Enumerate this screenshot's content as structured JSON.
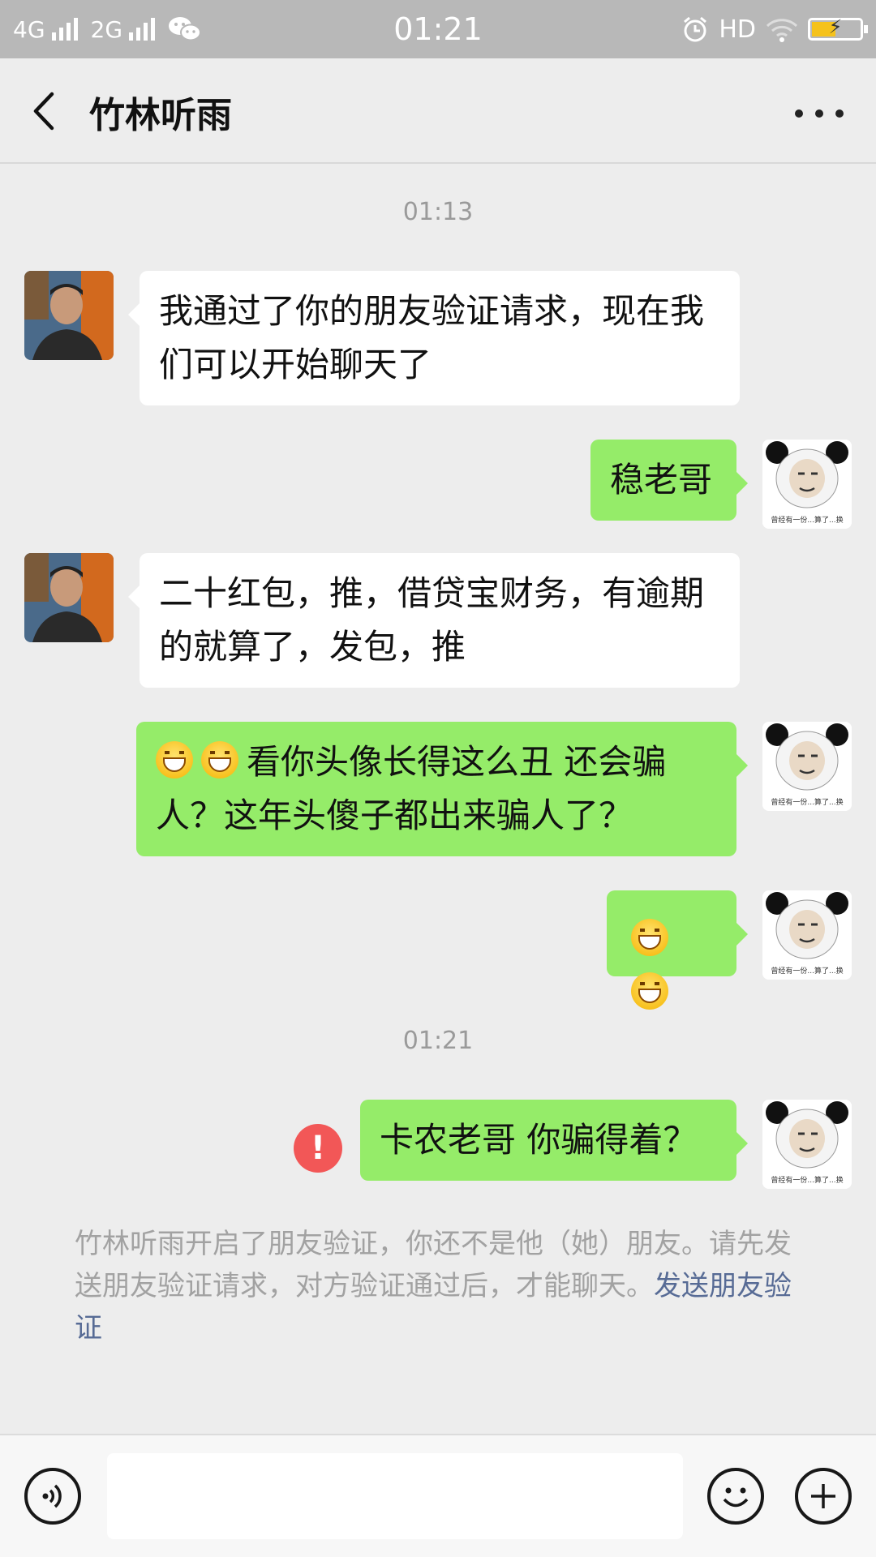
{
  "status_bar": {
    "network1": "4G",
    "network2": "2G",
    "time": "01:21",
    "hd": "HD"
  },
  "header": {
    "title": "竹林听雨"
  },
  "chat": {
    "timestamps": [
      "01:13",
      "01:21"
    ],
    "messages": [
      {
        "side": "in",
        "text": "我通过了你的朋友验证请求，现在我们可以开始聊天了"
      },
      {
        "side": "out",
        "text": "稳老哥"
      },
      {
        "side": "in",
        "text": "二十红包，推，借贷宝财务，有逾期的就算了，发包，推"
      },
      {
        "side": "out",
        "text": "看你头像长得这么丑  还会骗人？这年头傻子都出来骗人了？"
      },
      {
        "side": "out",
        "text": ""
      },
      {
        "side": "out",
        "text": "卡农老哥  你骗得着？",
        "failed": true
      }
    ],
    "panda_caption": "曾经有一份...算了...换",
    "error_mark": "!"
  },
  "notice": {
    "text": "竹林听雨开启了朋友验证，你还不是他（她）朋友。请先发送朋友验证请求，对方验证通过后，才能聊天。",
    "link": "发送朋友验证"
  },
  "input_bar": {
    "voice_icon": "voice-icon",
    "emoji_icon": "emoji-icon",
    "plus_icon": "plus-icon"
  },
  "colors": {
    "bubble_out": "#95ec69",
    "bubble_in": "#ffffff",
    "link": "#576b95",
    "error": "#f25757"
  }
}
